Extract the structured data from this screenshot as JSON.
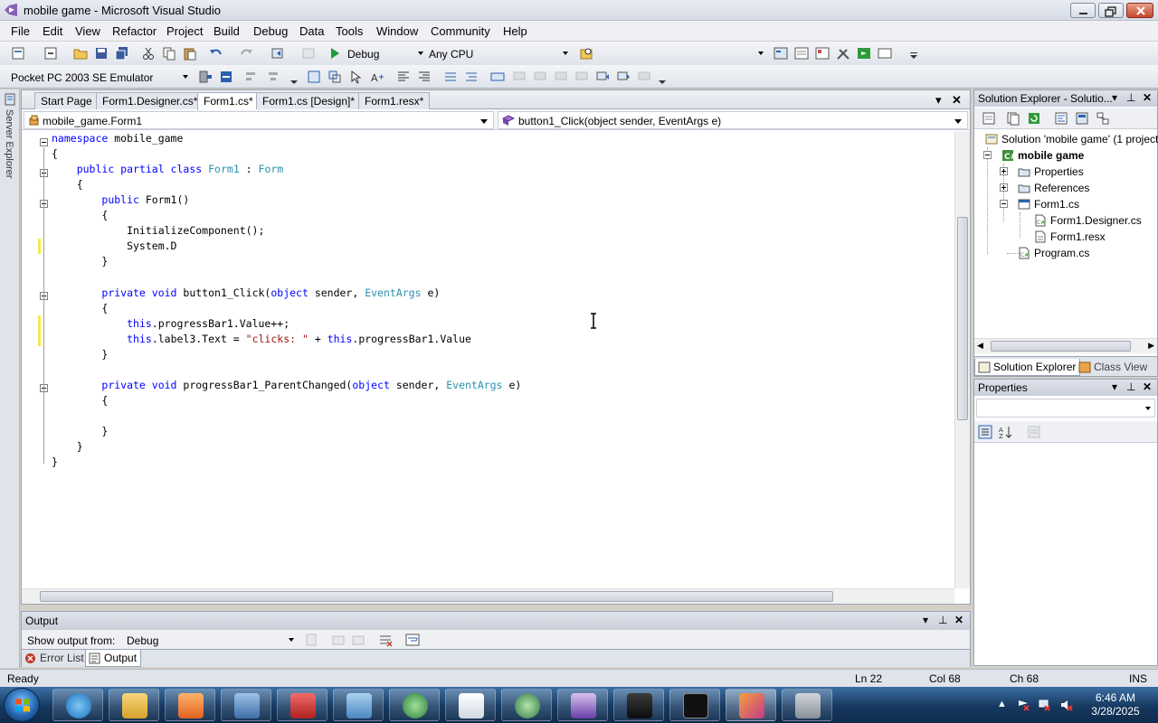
{
  "window": {
    "title": "mobile game - Microsoft Visual Studio",
    "buttons": [
      "minimize",
      "maximize",
      "close"
    ]
  },
  "menu": [
    "File",
    "Edit",
    "View",
    "Refactor",
    "Project",
    "Build",
    "Debug",
    "Data",
    "Tools",
    "Window",
    "Community",
    "Help"
  ],
  "toolbar": {
    "configuration": "Debug",
    "platform": "Any CPU",
    "device": "Pocket PC 2003 SE Emulator"
  },
  "side_strip": {
    "label": "Server Explorer"
  },
  "tabs": [
    {
      "label": "Start Page",
      "active": false
    },
    {
      "label": "Form1.Designer.cs*",
      "active": false
    },
    {
      "label": "Form1.cs*",
      "active": true
    },
    {
      "label": "Form1.cs [Design]*",
      "active": false
    },
    {
      "label": "Form1.resx*",
      "active": false
    }
  ],
  "nav": {
    "class_combo": "mobile_game.Form1",
    "member_combo": "button1_Click(object sender, EventArgs e)"
  },
  "code": [
    [
      [
        "kw",
        "namespace"
      ],
      [
        "",
        "mobile_game"
      ]
    ],
    [
      [
        "",
        "{"
      ]
    ],
    [
      [
        "",
        "    "
      ],
      [
        "kw",
        "public partial class"
      ],
      [
        "",
        ""
      ],
      [
        "ty",
        "Form1"
      ],
      [
        "",
        " : "
      ],
      [
        "ty",
        "Form"
      ]
    ],
    [
      [
        "",
        "    {"
      ]
    ],
    [
      [
        "",
        "        "
      ],
      [
        "kw",
        "public"
      ],
      [
        "",
        " Form1()"
      ]
    ],
    [
      [
        "",
        "        {"
      ]
    ],
    [
      [
        "",
        "            InitializeComponent();"
      ]
    ],
    [
      [
        "",
        "            System.D"
      ]
    ],
    [
      [
        "",
        "        }"
      ]
    ],
    [
      [
        "",
        ""
      ]
    ],
    [
      [
        "",
        "        "
      ],
      [
        "kw",
        "private void"
      ],
      [
        "",
        " button1_Click("
      ],
      [
        "kw",
        "object"
      ],
      [
        "",
        " sender, "
      ],
      [
        "ty",
        "EventArgs"
      ],
      [
        "",
        " e)"
      ]
    ],
    [
      [
        "",
        "        {"
      ]
    ],
    [
      [
        "",
        "            "
      ],
      [
        "kw",
        "this"
      ],
      [
        "",
        ".progressBar1.Value++;"
      ]
    ],
    [
      [
        "",
        "            "
      ],
      [
        "kw",
        "this"
      ],
      [
        "",
        ".label3.Text = "
      ],
      [
        "st",
        "\"clicks: \""
      ],
      [
        "",
        " + "
      ],
      [
        "kw",
        "this"
      ],
      [
        "",
        ".progressBar1.Value"
      ]
    ],
    [
      [
        "",
        "        }"
      ]
    ],
    [
      [
        "",
        ""
      ]
    ],
    [
      [
        "",
        "        "
      ],
      [
        "kw",
        "private void"
      ],
      [
        "",
        " progressBar1_ParentChanged("
      ],
      [
        "kw",
        "object"
      ],
      [
        "",
        " sender, "
      ],
      [
        "ty",
        "EventArgs"
      ],
      [
        "",
        " e)"
      ]
    ],
    [
      [
        "",
        "        {"
      ]
    ],
    [
      [
        "",
        ""
      ]
    ],
    [
      [
        "",
        "        }"
      ]
    ],
    [
      [
        "",
        "    }"
      ]
    ],
    [
      [
        "",
        "}"
      ]
    ]
  ],
  "solution_explorer": {
    "title": "Solution Explorer - Solutio...",
    "tree": [
      {
        "label": "Solution 'mobile game' (1 project)",
        "bold": false
      },
      {
        "label": "mobile game",
        "bold": true
      },
      {
        "label": "Properties",
        "bold": false
      },
      {
        "label": "References",
        "bold": false
      },
      {
        "label": "Form1.cs",
        "bold": false
      },
      {
        "label": "Form1.Designer.cs",
        "bold": false
      },
      {
        "label": "Form1.resx",
        "bold": false
      },
      {
        "label": "Program.cs",
        "bold": false
      }
    ],
    "bottom_tabs": [
      "Solution Explorer",
      "Class View"
    ]
  },
  "properties": {
    "title": "Properties"
  },
  "output": {
    "title": "Output",
    "show_from_label": "Show output from:",
    "show_from_value": "Debug",
    "tabs": [
      "Error List",
      "Output"
    ]
  },
  "status": {
    "state": "Ready",
    "line": "Ln 22",
    "col": "Col 68",
    "ch": "Ch 68",
    "mode": "INS"
  },
  "taskbar": {
    "time": "6:46 AM",
    "date": "3/28/2025"
  }
}
